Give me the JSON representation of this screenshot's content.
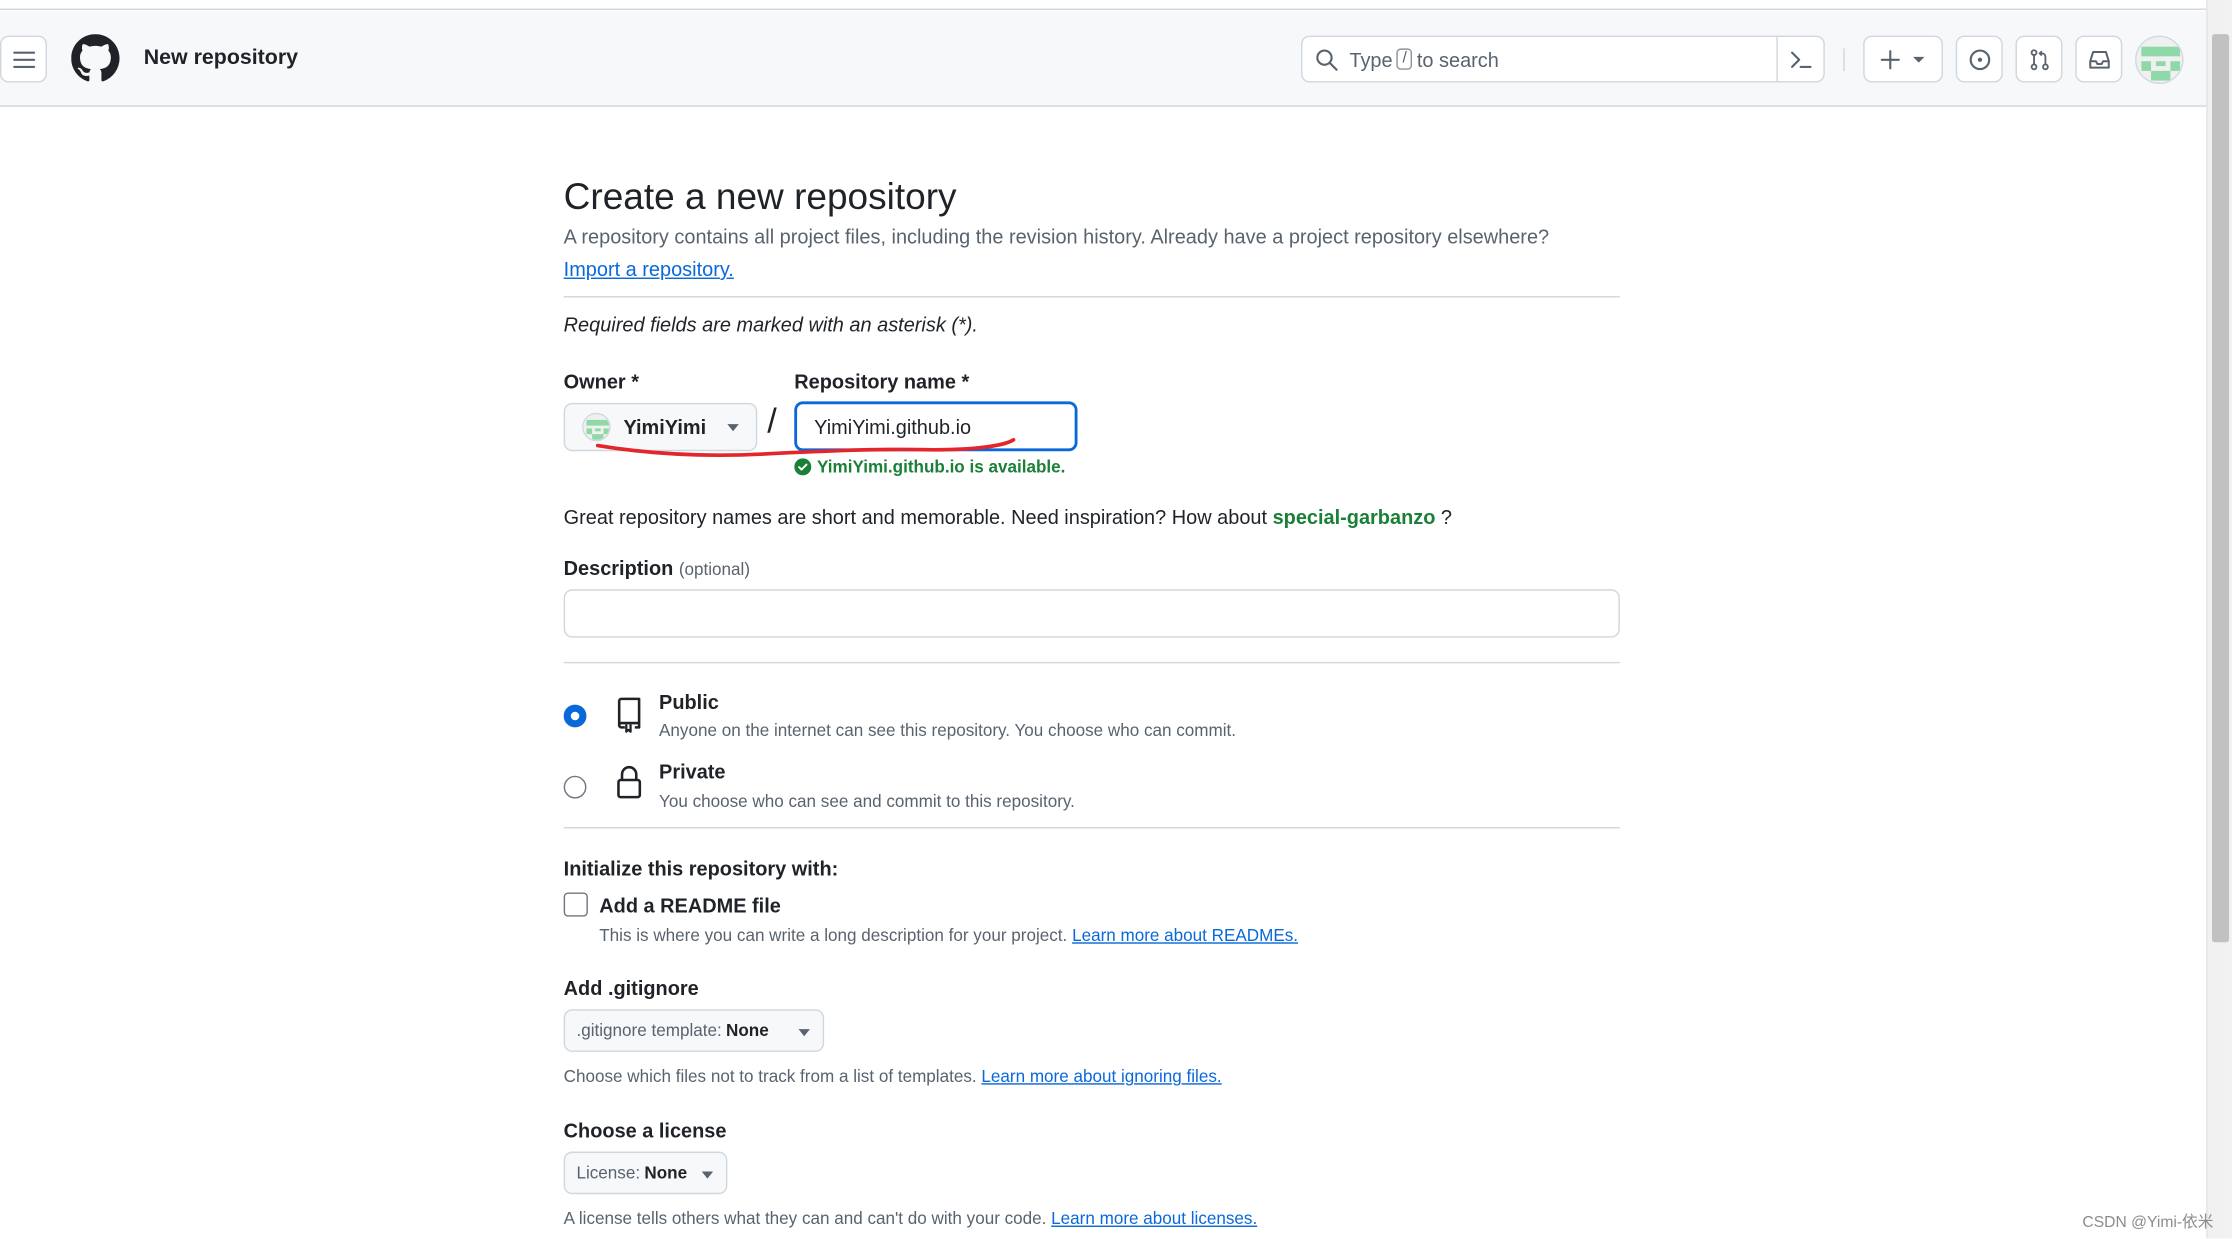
{
  "header": {
    "context_title": "New repository",
    "search_prefix": "Type",
    "search_key": "/",
    "search_suffix": "to search"
  },
  "main": {
    "title": "Create a new repository",
    "subtitle": "A repository contains all project files, including the revision history. Already have a project repository elsewhere?",
    "import_link": "Import a repository.",
    "required_note": "Required fields are marked with an asterisk (*).",
    "owner_label": "Owner *",
    "owner_value": "YimiYimi",
    "repo_label": "Repository name *",
    "repo_value": "YimiYimi.github.io",
    "available_msg": "YimiYimi.github.io is available.",
    "inspire_text": "Great repository names are short and memorable. Need inspiration? How about",
    "inspire_suggestion": "special-garbanzo",
    "inspire_end": "?",
    "description_label": "Description",
    "description_optional": "(optional)",
    "description_value": "",
    "visibility": {
      "selected": "public",
      "public_title": "Public",
      "public_desc": "Anyone on the internet can see this repository. You choose who can commit.",
      "private_title": "Private",
      "private_desc": "You choose who can see and commit to this repository."
    },
    "init": {
      "title": "Initialize this repository with:",
      "readme_label": "Add a README file",
      "readme_checked": false,
      "readme_desc": "This is where you can write a long description for your project.",
      "readme_link": "Learn more about READMEs."
    },
    "gitignore": {
      "title": "Add .gitignore",
      "select_prefix": ".gitignore template:",
      "select_value": "None",
      "note": "Choose which files not to track from a list of templates.",
      "note_link": "Learn more about ignoring files."
    },
    "license": {
      "title": "Choose a license",
      "select_prefix": "License:",
      "select_value": "None",
      "note": "A license tells others what they can and can't do with your code.",
      "note_link": "Learn more about licenses."
    }
  },
  "watermark": "CSDN @Yimi-依米",
  "colors": {
    "accent": "#0969da",
    "success": "#1a7f37",
    "annotation": "#e3262c"
  }
}
